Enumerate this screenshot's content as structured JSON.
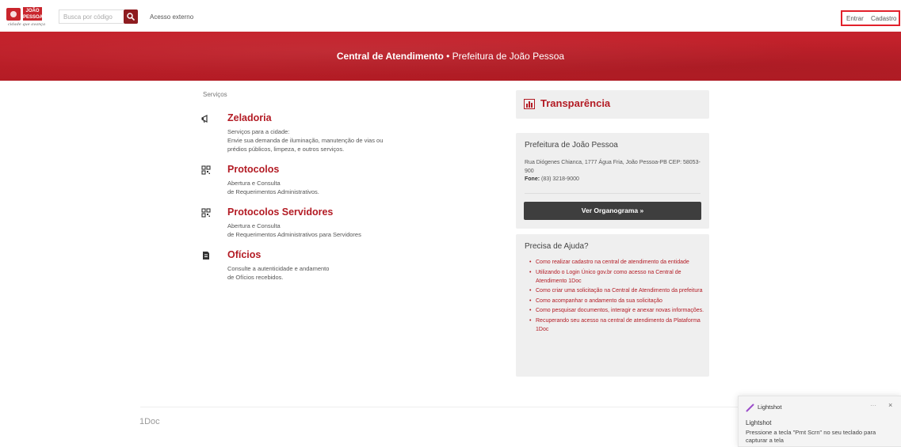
{
  "header": {
    "logo_word": "JOÃO PESSOA",
    "logo_tagline": "cidade que avança",
    "search": {
      "placeholder": "Busca por código",
      "icon": "search-icon"
    },
    "external_access": "Acesso externo",
    "auth": {
      "login": "Entrar",
      "signup": "Cadastro"
    }
  },
  "banner": {
    "title_bold": "Central de Atendimento",
    "separator": " • ",
    "title_sub": "Prefeitura de João Pessoa"
  },
  "services": {
    "label": "Serviços",
    "items": [
      {
        "title": "Zeladoria",
        "icon": "megaphone-icon",
        "lines": [
          "Serviços para a cidade:",
          "Envie sua demanda de iluminação, manutenção de vias ou",
          "prédios públicos, limpeza, e outros serviços."
        ]
      },
      {
        "title": "Protocolos",
        "icon": "qrcode-icon",
        "lines": [
          "Abertura e Consulta",
          "de Requerimentos Administrativos."
        ]
      },
      {
        "title": "Protocolos Servidores",
        "icon": "qrcode-icon",
        "lines": [
          "Abertura e Consulta",
          "de Requerimentos Administrativos para Servidores"
        ]
      },
      {
        "title": "Ofícios",
        "icon": "document-icon",
        "lines": [
          "Consulte a autenticidade e andamento",
          "de Ofícios recebidos."
        ]
      }
    ]
  },
  "transparency": {
    "title": "Transparência",
    "icon": "bar-chart-icon"
  },
  "prefeitura": {
    "title": "Prefeitura de João Pessoa",
    "address": "Rua Diógenes Chianca, 1777 Água Fria, João Pessoa-PB CEP: 58053-900",
    "phone_label": "Fone:",
    "phone": "(83) 3218-9000",
    "org_button": "Ver Organograma »"
  },
  "help": {
    "title": "Precisa de Ajuda?",
    "links": [
      "Como realizar cadastro na central de atendimento da entidade",
      "Utilizando o Login Único gov.br como acesso na Central de Atendimento 1Doc",
      "Como criar uma solicitação na Central de Atendimento da prefeitura",
      "Como acompanhar o andamento da sua solicitação",
      "Como pesquisar documentos, interagir e anexar novas informações.",
      "Recuperando seu acesso na central de atendimento da Plataforma 1Doc"
    ]
  },
  "footer": {
    "brand": "1Doc"
  },
  "toast": {
    "app": "Lightshot",
    "more": "···",
    "close": "×",
    "title": "Lightshot",
    "message": "Pressione a tecla \"Prnt Scrn\" no seu teclado para capturar a tela"
  },
  "colors": {
    "brand_red": "#c5222c",
    "link_red": "#b31b24",
    "button_dark": "#3e3e3e",
    "highlight_box": "#e2212b"
  }
}
